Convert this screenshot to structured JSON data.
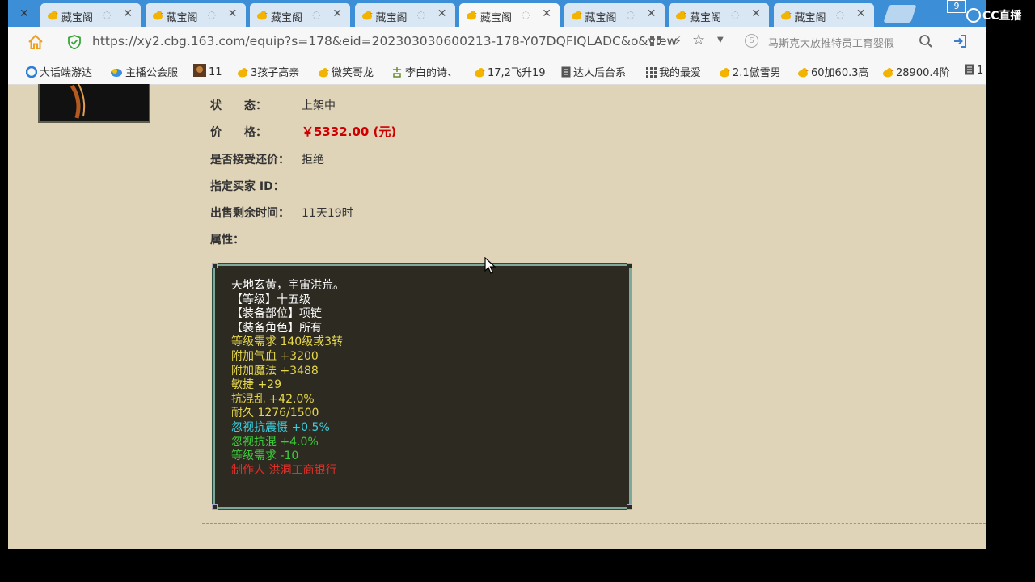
{
  "browser": {
    "tabs": [
      {
        "title": "藏宝阁_"
      },
      {
        "title": "藏宝阁_"
      },
      {
        "title": "藏宝阁_"
      },
      {
        "title": "藏宝阁_"
      },
      {
        "title": "藏宝阁_",
        "active": true
      },
      {
        "title": "藏宝阁_"
      },
      {
        "title": "藏宝阁_"
      },
      {
        "title": "藏宝阁_"
      }
    ],
    "tab_count": "9",
    "url": "https://xy2.cbg.163.com/equip?s=178&eid=202303030600213-178-Y07DQFIQLADC&o&view",
    "search_placeholder": "马斯克大放推特员工育婴假",
    "bookmarks": [
      {
        "label": "大话端游达",
        "icon": "swirl-icon"
      },
      {
        "label": "主播公会服",
        "icon": "cloud-icon"
      },
      {
        "label": "11",
        "icon": "avatar-icon"
      },
      {
        "label": "3孩子高亲",
        "icon": "duck-icon"
      },
      {
        "label": "微笑哥龙",
        "icon": "duck-icon"
      },
      {
        "label": "李白的诗、",
        "icon": "ji-icon"
      },
      {
        "label": "17,2飞升19",
        "icon": "duck-icon"
      },
      {
        "label": "达人后台系",
        "icon": "doc-icon"
      },
      {
        "label": "我的最爱",
        "icon": "grid-icon"
      },
      {
        "label": "2.1傲雪男",
        "icon": "duck-icon"
      },
      {
        "label": "60加60.3高",
        "icon": "duck-icon"
      },
      {
        "label": "28900.4阶",
        "icon": "duck-icon"
      },
      {
        "label": "1",
        "icon": "doc-icon"
      }
    ]
  },
  "watermark": "CC直播",
  "item": {
    "status_label": "状　　态：",
    "status_value": "上架中",
    "price_label": "价　　格：",
    "price_value": "￥5332.00 (元)",
    "counter_label": "是否接受还价：",
    "counter_value": "拒绝",
    "buyer_label": "指定买家 ID：",
    "buyer_value": "",
    "time_label": "出售剩余时间：",
    "time_value": "11天19时",
    "attr_label": "属性："
  },
  "tooltip": {
    "lines": [
      {
        "text": "天地玄黄，宇宙洪荒。",
        "color": "#ffffff"
      },
      {
        "text": "【等级】十五级",
        "color": "#ffffff"
      },
      {
        "text": "【装备部位】项链",
        "color": "#ffffff"
      },
      {
        "text": "【装备角色】所有",
        "color": "#ffffff"
      },
      {
        "text": "等级需求 140级或3转",
        "color": "#e6d84a"
      },
      {
        "text": "附加气血 +3200",
        "color": "#e6d84a"
      },
      {
        "text": "附加魔法 +3488",
        "color": "#e6d84a"
      },
      {
        "text": "敏捷 +29",
        "color": "#e6d84a"
      },
      {
        "text": "抗混乱 +42.0%",
        "color": "#e6d84a"
      },
      {
        "text": "耐久 1276/1500",
        "color": "#e6d84a"
      },
      {
        "text": "忽视抗震慑 +0.5%",
        "color": "#3ad0e0"
      },
      {
        "text": "忽视抗混 +4.0%",
        "color": "#3ccf3c"
      },
      {
        "text": "等级需求 -10",
        "color": "#3ccf3c"
      },
      {
        "text": "制作人 洪洞工商银行",
        "color": "#e0302a"
      }
    ]
  }
}
